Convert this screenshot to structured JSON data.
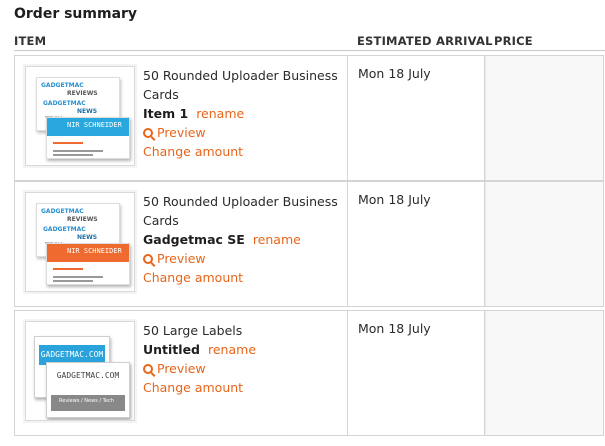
{
  "title": "Order summary",
  "columns": {
    "item": "ITEM",
    "arrival": "ESTIMATED ARRIVAL",
    "price": "PRICE"
  },
  "accent_color": "#e8651a",
  "rows": [
    {
      "name": "50 Rounded Uploader Business Cards",
      "subtitle": "Item 1",
      "rename": "rename",
      "preview": "Preview",
      "change": "Change amount",
      "arrival": "Mon 18 July",
      "thumb": {
        "kind": "business-card",
        "band_color": "#29a8df",
        "band_text": "NIR SCHNEIDER"
      }
    },
    {
      "name": "50 Rounded Uploader Business Cards",
      "subtitle": "Gadgetmac SE",
      "rename": "rename",
      "preview": "Preview",
      "change": "Change amount",
      "arrival": "Mon 18 July",
      "thumb": {
        "kind": "business-card",
        "band_color": "#ee6a2f",
        "band_text": "NIR SCHNEIDER"
      }
    },
    {
      "name": "50 Large Labels",
      "subtitle": "Untitled",
      "rename": "rename",
      "preview": "Preview",
      "change": "Change amount",
      "arrival": "Mon 18 July",
      "thumb": {
        "kind": "label",
        "back_text": "GADGETMAC.COM",
        "front_text": "GADGETMAC.COM",
        "front_sub": "Reviews / News / Tech"
      }
    }
  ]
}
